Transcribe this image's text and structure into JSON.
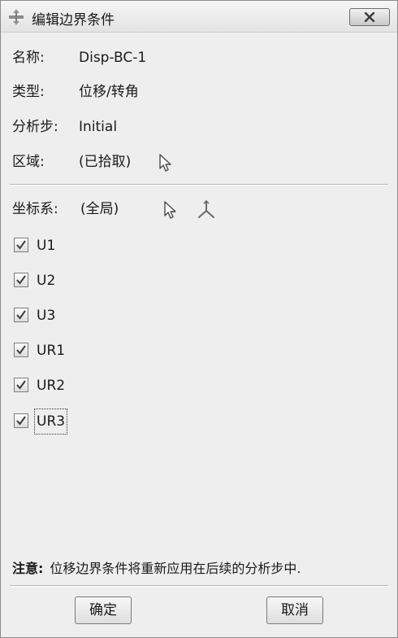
{
  "window": {
    "title": "编辑边界条件",
    "close_label": "×"
  },
  "fields": {
    "name_label": "名称:",
    "name_value": "Disp-BC-1",
    "type_label": "类型:",
    "type_value": "位移/转角",
    "step_label": "分析步:",
    "step_value": "Initial",
    "region_label": "区域:",
    "region_value": "(已拾取)"
  },
  "csys": {
    "label": "坐标系:",
    "value": "(全局)"
  },
  "dofs": [
    {
      "label": "U1",
      "checked": true
    },
    {
      "label": "U2",
      "checked": true
    },
    {
      "label": "U3",
      "checked": true
    },
    {
      "label": "UR1",
      "checked": true
    },
    {
      "label": "UR2",
      "checked": true
    },
    {
      "label": "UR3",
      "checked": true
    }
  ],
  "note": {
    "label": "注意:",
    "text": "位移边界条件将重新应用在后续的分析步中."
  },
  "buttons": {
    "ok": "确定",
    "cancel": "取消"
  },
  "icons": {
    "app": "abaqus-app-icon",
    "select": "select-cursor-icon",
    "csys": "csys-axes-icon",
    "check": "checkmark-icon"
  }
}
